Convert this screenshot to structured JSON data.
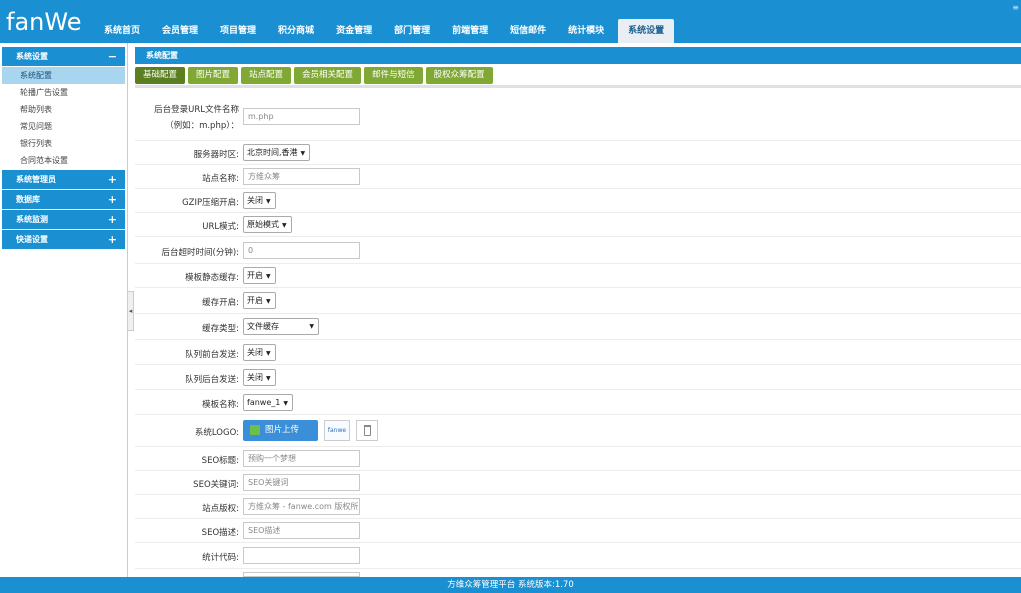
{
  "header": {
    "logo": "fanWe",
    "corner": "≡",
    "nav": [
      "系统首页",
      "会员管理",
      "项目管理",
      "积分商城",
      "资金管理",
      "部门管理",
      "前端管理",
      "短信邮件",
      "统计模块",
      "系统设置"
    ],
    "active_nav": "系统设置"
  },
  "sidebar": {
    "section_title": "系统设置",
    "section_toggle": "−",
    "items": [
      "系统配置",
      "轮播广告设置",
      "帮助列表",
      "常见问题",
      "银行列表",
      "合同范本设置"
    ],
    "groups": [
      {
        "label": "系统管理员",
        "toggle": "+"
      },
      {
        "label": "数据库",
        "toggle": "+"
      },
      {
        "label": "系统监测",
        "toggle": "+"
      },
      {
        "label": "快递设置",
        "toggle": "+"
      }
    ],
    "collapse_glyph": "◂"
  },
  "main": {
    "panel_title": "系统配置",
    "tabs": [
      "基础配置",
      "图片配置",
      "站点配置",
      "会员相关配置",
      "邮件与短信",
      "股权众筹配置"
    ],
    "fields": {
      "admin_url": {
        "label": "后台登录URL文件名称",
        "label2": "（例如：m.php）：",
        "value": "m.php"
      },
      "timezone": {
        "label": "服务器时区:",
        "value": "北京时间,香港"
      },
      "site_name": {
        "label": "站点名称:",
        "value": "方维众筹"
      },
      "gzip": {
        "label": "GZIP压缩开启:",
        "value": "关闭"
      },
      "url_mode": {
        "label": "URL模式:",
        "value": "原始模式"
      },
      "timeout": {
        "label": "后台超时时间(分钟):",
        "value": "0"
      },
      "tpl_cache": {
        "label": "模板静态缓存:",
        "value": "开启"
      },
      "cache_on": {
        "label": "缓存开启:",
        "value": "开启"
      },
      "cache_type": {
        "label": "缓存类型:",
        "value": "文件缓存"
      },
      "queue_front": {
        "label": "队列前台发送:",
        "value": "关闭"
      },
      "queue_back": {
        "label": "队列后台发送:",
        "value": "关闭"
      },
      "tpl_name": {
        "label": "模板名称:",
        "value": "fanwe_1"
      },
      "logo": {
        "label": "系统LOGO:",
        "upload_label": "图片上传",
        "thumb_text": "fanwe"
      },
      "seo_title": {
        "label": "SEO标题:",
        "value": "预购一个梦想"
      },
      "seo_keywords": {
        "label": "SEO关键词:",
        "value": "SEO关键词"
      },
      "copyright": {
        "label": "站点版权:",
        "value": "方维众筹 - fanwe.com 版权所"
      },
      "seo_desc": {
        "label": "SEO描述:",
        "value": "SEO描述"
      },
      "stat_code": {
        "label": "统计代码:",
        "value": ""
      }
    },
    "select_arrow": "▼"
  },
  "footer": {
    "text": "方维众筹管理平台 系统版本:1.70"
  }
}
